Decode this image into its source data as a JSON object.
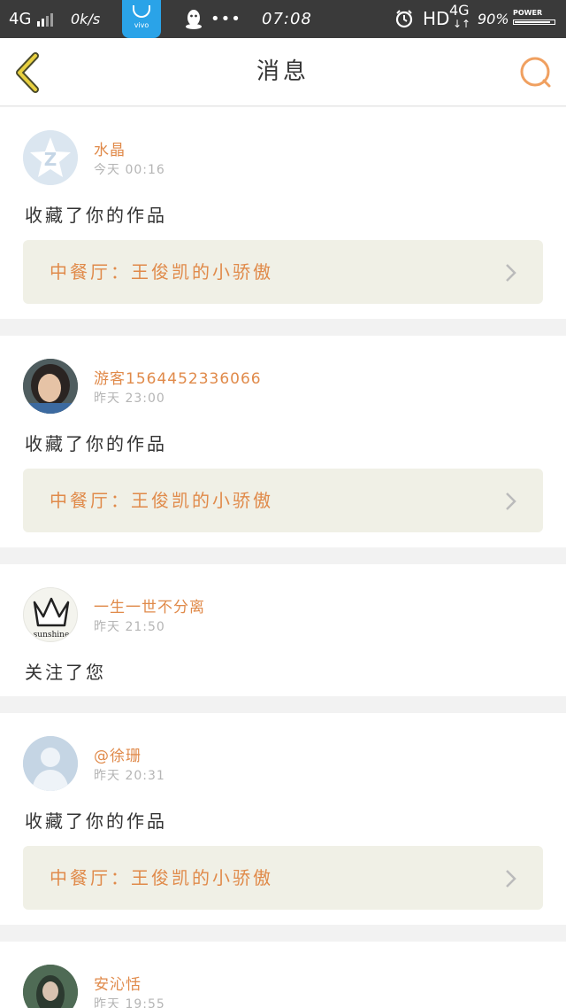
{
  "status_bar": {
    "network": "4G",
    "speed": "0k/s",
    "vivo_label": "vivo",
    "dots": "•••",
    "time": "07:08",
    "hd": "HD",
    "network2": "4G",
    "arrows": "↓↑",
    "battery": "90%",
    "power_label": "POWER",
    "battery_level": 0.9
  },
  "nav": {
    "title": "消息",
    "accent_color": "#f0a060"
  },
  "messages": [
    {
      "name": "水晶",
      "time": "今天 00:16",
      "action": "收藏了你的作品",
      "work": "中餐厅：王俊凯的小骄傲"
    },
    {
      "name": "游客1564452336066",
      "time": "昨天 23:00",
      "action": "收藏了你的作品",
      "work": "中餐厅：王俊凯的小骄傲"
    },
    {
      "name": "一生一世不分离",
      "time": "昨天 21:50",
      "action": "关注了您",
      "avatar_text": "sunshine"
    },
    {
      "name": "@徐珊",
      "time": "昨天 20:31",
      "action": "收藏了你的作品",
      "work": "中餐厅：王俊凯的小骄傲"
    },
    {
      "name": "安沁恬",
      "time": "昨天 19:55"
    }
  ]
}
